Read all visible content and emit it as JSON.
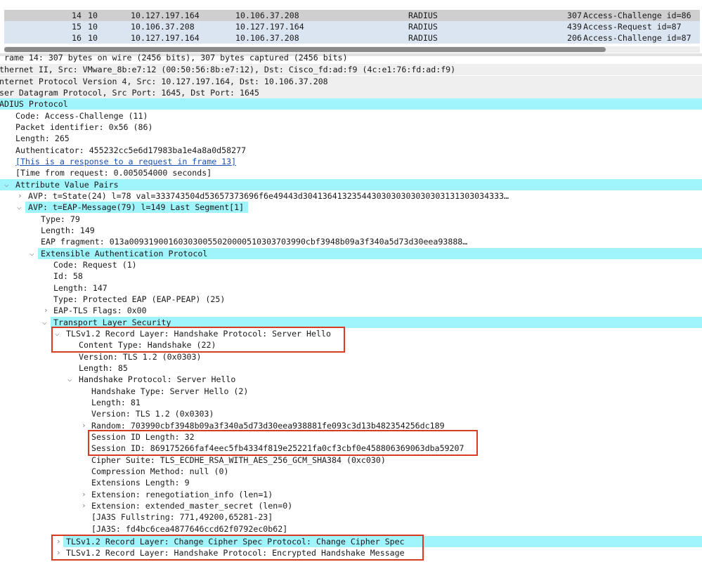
{
  "packet_list": {
    "rows": [
      {
        "no": "14",
        "time": "10",
        "src": "10.127.197.164",
        "dst": "10.106.37.208",
        "proto": "RADIUS",
        "len": "307",
        "info": "Access-Challenge id=86"
      },
      {
        "no": "15",
        "time": "10",
        "src": "10.106.37.208",
        "dst": "10.127.197.164",
        "proto": "RADIUS",
        "len": "439",
        "info": "Access-Request id=87"
      },
      {
        "no": "16",
        "time": "10",
        "src": "10.127.197.164",
        "dst": "10.106.37.208",
        "proto": "RADIUS",
        "len": "206",
        "info": "Access-Challenge id=87"
      }
    ]
  },
  "details": {
    "lines": [
      {
        "text": "rame 14: 307 bytes on wire (2456 bits), 307 bytes captured (2456 bits)"
      },
      {
        "text": "thernet II, Src: VMware_8b:e7:12 (00:50:56:8b:e7:12), Dst: Cisco_fd:ad:f9 (4c:e1:76:fd:ad:f9)"
      },
      {
        "text": "nternet Protocol Version 4, Src: 10.127.197.164, Dst: 10.106.37.208"
      },
      {
        "text": "ser Datagram Protocol, Src Port: 1645, Dst Port: 1645"
      },
      {
        "text": "ADIUS Protocol"
      },
      {
        "text": "Code: Access-Challenge (11)"
      },
      {
        "text": "Packet identifier: 0x56 (86)"
      },
      {
        "text": "Length: 265"
      },
      {
        "text": "Authenticator: 455232cc5e6d17983ba1e4a8a0d58277"
      },
      {
        "text": "[This is a response to a request in frame 13]"
      },
      {
        "text": "[Time from request: 0.005054000 seconds]"
      },
      {
        "text": "Attribute Value Pairs"
      },
      {
        "text": "AVP: t=State(24) l=78 val=333743504d53657373696f6e49443d30413641323544303030303030303131303034333…"
      },
      {
        "text": "AVP: t=EAP-Message(79) l=149 Last Segment[1]"
      },
      {
        "text": "Type: 79"
      },
      {
        "text": "Length: 149"
      },
      {
        "text": "EAP fragment: 013a009319001603030055020000510303703990cbf3948b09a3f340a5d73d30eea93888…"
      },
      {
        "text": "Extensible Authentication Protocol"
      },
      {
        "text": "Code: Request (1)"
      },
      {
        "text": "Id: 58"
      },
      {
        "text": "Length: 147"
      },
      {
        "text": "Type: Protected EAP (EAP-PEAP) (25)"
      },
      {
        "text": "EAP-TLS Flags: 0x00"
      },
      {
        "text": "Transport Layer Security"
      },
      {
        "text": "TLSv1.2 Record Layer: Handshake Protocol: Server Hello"
      },
      {
        "text": "Content Type: Handshake (22)"
      },
      {
        "text": "Version: TLS 1.2 (0x0303)"
      },
      {
        "text": "Length: 85"
      },
      {
        "text": "Handshake Protocol: Server Hello"
      },
      {
        "text": "Handshake Type: Server Hello (2)"
      },
      {
        "text": "Length: 81"
      },
      {
        "text": "Version: TLS 1.2 (0x0303)"
      },
      {
        "text": "Random: 703990cbf3948b09a3f340a5d73d30eea938881fe093c3d13b482354256dc189"
      },
      {
        "text": "Session ID Length: 32"
      },
      {
        "text": "Session ID: 869175266faf4eec5fb4334f819e25221fa0cf3cbf0e458806369063dba59207"
      },
      {
        "text": "Cipher Suite: TLS_ECDHE_RSA_WITH_AES_256_GCM_SHA384 (0xc030)"
      },
      {
        "text": "Compression Method: null (0)"
      },
      {
        "text": "Extensions Length: 9"
      },
      {
        "text": "Extension: renegotiation_info (len=1)"
      },
      {
        "text": "Extension: extended_master_secret (len=0)"
      },
      {
        "text": "[JA3S Fullstring: 771,49200,65281-23]"
      },
      {
        "text": "[JA3S: fd4bc6cea4877646ccd62f0792ec0b62]"
      },
      {
        "text": "TLSv1.2 Record Layer: Change Cipher Spec Protocol: Change Cipher Spec"
      },
      {
        "text": "TLSv1.2 Record Layer: Handshake Protocol: Encrypted Handshake Message"
      }
    ]
  },
  "colors": {
    "selection_bar": "#a0f4fb",
    "highlight_box": "#d93a22",
    "link": "#1a4fb5",
    "alt_row": "#dbe5f2"
  }
}
